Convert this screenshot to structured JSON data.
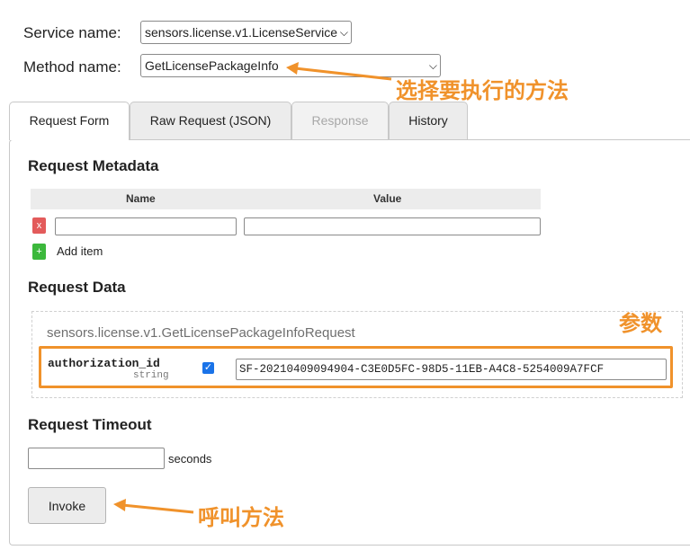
{
  "form": {
    "service_label": "Service name:",
    "service_value": "sensors.license.v1.LicenseService",
    "method_label": "Method name:",
    "method_value": "GetLicensePackageInfo"
  },
  "tabs": [
    {
      "label": "Request Form",
      "state": "active"
    },
    {
      "label": "Raw Request (JSON)",
      "state": "normal"
    },
    {
      "label": "Response",
      "state": "disabled"
    },
    {
      "label": "History",
      "state": "normal"
    }
  ],
  "metadata": {
    "title": "Request Metadata",
    "col_name": "Name",
    "col_value": "Value",
    "remove_icon": "x",
    "add_icon": "+",
    "add_label": "Add item"
  },
  "request_data": {
    "title": "Request Data",
    "message_type": "sensors.license.v1.GetLicensePackageInfoRequest",
    "field_name": "authorization_id",
    "field_type": "string",
    "field_checked": true,
    "field_value": "SF-20210409094904-C3E0D5FC-98D5-11EB-A4C8-5254009A7FCF"
  },
  "timeout": {
    "title": "Request Timeout",
    "value": "",
    "unit": "seconds"
  },
  "invoke_label": "Invoke",
  "annotations": {
    "select_method": "选择要执行的方法",
    "params": "参数",
    "call_method": "呼叫方法",
    "color": "#f0922b"
  }
}
